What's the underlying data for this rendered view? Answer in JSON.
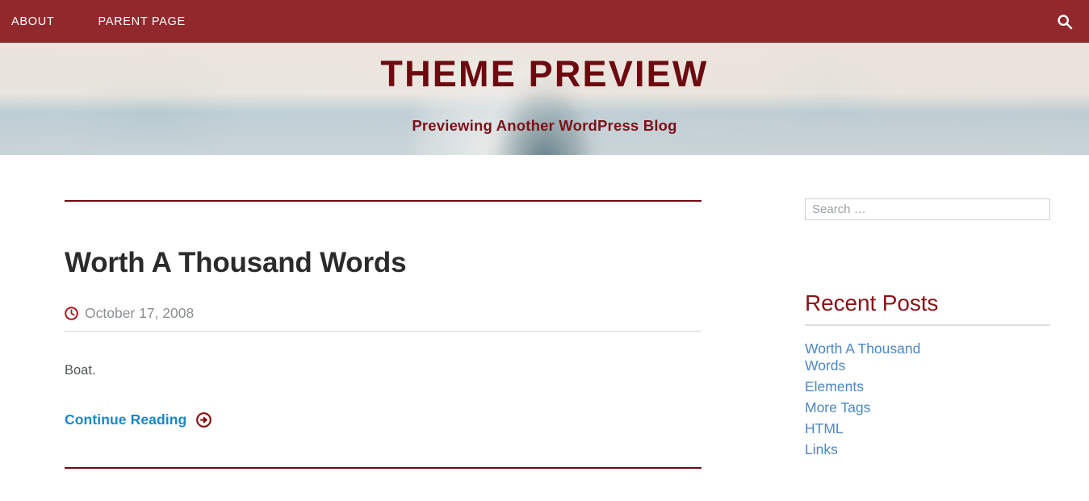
{
  "nav": {
    "items": [
      {
        "label": "About",
        "name": "nav-item-about"
      },
      {
        "label": "Parent Page",
        "name": "nav-item-parent-page"
      }
    ],
    "search_icon": "search-icon",
    "bar_color": "#91282c"
  },
  "header": {
    "title": "THEME PREVIEW",
    "tagline": "Previewing Another WordPress Blog",
    "title_color": "#6d0a10"
  },
  "post": {
    "title": "Worth A Thousand Words",
    "date": "October 17, 2008",
    "date_icon": "clock-icon",
    "body": "Boat.",
    "continue_label": "Continue Reading",
    "continue_icon": "arrow-circle-right-icon",
    "link_color": "#1a87c8",
    "rule_color": "#6d0a10"
  },
  "sidebar": {
    "search": {
      "placeholder": "Search …",
      "value": ""
    },
    "recent_posts": {
      "title": "Recent Posts",
      "title_color": "#8b1216",
      "items": [
        {
          "label": "Worth A Thousand Words"
        },
        {
          "label": "Elements"
        },
        {
          "label": "More Tags"
        },
        {
          "label": "HTML"
        },
        {
          "label": "Links"
        }
      ]
    }
  }
}
